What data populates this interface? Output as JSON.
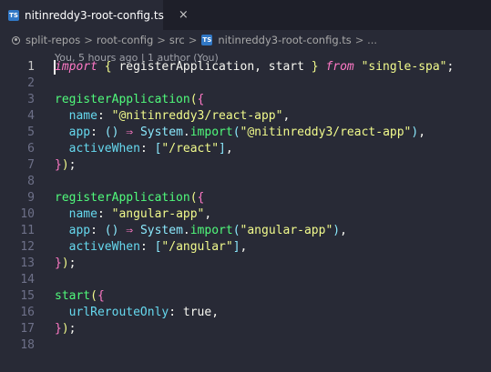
{
  "tab": {
    "label": "nitinreddy3-root-config.ts",
    "icon": "typescript-file-icon",
    "close_glyph": "×",
    "icon_text": "TS"
  },
  "breadcrumb": {
    "icon": "repo-icon",
    "items": [
      "split-repos",
      "root-config",
      "src"
    ],
    "separator": ">",
    "file": "nitinreddy3-root-config.ts",
    "ellipsis": "> ..."
  },
  "codelens": "You, 5 hours ago | 1 author (You)",
  "active_line": 1,
  "colors": {
    "background": "#282a36",
    "keyword": "#ff79c6",
    "function": "#50fa7b",
    "string": "#f1fa8c",
    "property": "#66d9ef"
  },
  "lines": [
    {
      "n": "1",
      "tokens": [
        {
          "t": "import",
          "c": "kw"
        },
        {
          "t": " ",
          "c": "txt"
        },
        {
          "t": "{",
          "c": "b1"
        },
        {
          "t": " registerApplication, start ",
          "c": "txt"
        },
        {
          "t": "}",
          "c": "b1"
        },
        {
          "t": " ",
          "c": "txt"
        },
        {
          "t": "from",
          "c": "kw"
        },
        {
          "t": " ",
          "c": "txt"
        },
        {
          "t": "\"single-spa\"",
          "c": "str"
        },
        {
          "t": ";",
          "c": "txt"
        }
      ]
    },
    {
      "n": "2",
      "tokens": []
    },
    {
      "n": "3",
      "tokens": [
        {
          "t": "registerApplication",
          "c": "fn"
        },
        {
          "t": "(",
          "c": "b1"
        },
        {
          "t": "{",
          "c": "b2"
        }
      ]
    },
    {
      "n": "4",
      "tokens": [
        {
          "t": "  ",
          "c": "txt"
        },
        {
          "t": "name",
          "c": "prop"
        },
        {
          "t": ": ",
          "c": "txt"
        },
        {
          "t": "\"@nitinreddy3/react-app\"",
          "c": "str"
        },
        {
          "t": ",",
          "c": "txt"
        }
      ]
    },
    {
      "n": "5",
      "tokens": [
        {
          "t": "  ",
          "c": "txt"
        },
        {
          "t": "app",
          "c": "prop"
        },
        {
          "t": ": ",
          "c": "txt"
        },
        {
          "t": "()",
          "c": "b3"
        },
        {
          "t": " ",
          "c": "txt"
        },
        {
          "t": "⇒",
          "c": "op"
        },
        {
          "t": " ",
          "c": "txt"
        },
        {
          "t": "System",
          "c": "obj"
        },
        {
          "t": ".",
          "c": "txt"
        },
        {
          "t": "import",
          "c": "fn"
        },
        {
          "t": "(",
          "c": "b3"
        },
        {
          "t": "\"@nitinreddy3/react-app\"",
          "c": "str"
        },
        {
          "t": ")",
          "c": "b3"
        },
        {
          "t": ",",
          "c": "txt"
        }
      ]
    },
    {
      "n": "6",
      "tokens": [
        {
          "t": "  ",
          "c": "txt"
        },
        {
          "t": "activeWhen",
          "c": "prop"
        },
        {
          "t": ": ",
          "c": "txt"
        },
        {
          "t": "[",
          "c": "b3"
        },
        {
          "t": "\"/react\"",
          "c": "str"
        },
        {
          "t": "]",
          "c": "b3"
        },
        {
          "t": ",",
          "c": "txt"
        }
      ]
    },
    {
      "n": "7",
      "tokens": [
        {
          "t": "}",
          "c": "b2"
        },
        {
          "t": ")",
          "c": "b1"
        },
        {
          "t": ";",
          "c": "txt"
        }
      ]
    },
    {
      "n": "8",
      "tokens": []
    },
    {
      "n": "9",
      "tokens": [
        {
          "t": "registerApplication",
          "c": "fn"
        },
        {
          "t": "(",
          "c": "b1"
        },
        {
          "t": "{",
          "c": "b2"
        }
      ]
    },
    {
      "n": "10",
      "tokens": [
        {
          "t": "  ",
          "c": "txt"
        },
        {
          "t": "name",
          "c": "prop"
        },
        {
          "t": ": ",
          "c": "txt"
        },
        {
          "t": "\"angular-app\"",
          "c": "str"
        },
        {
          "t": ",",
          "c": "txt"
        }
      ]
    },
    {
      "n": "11",
      "tokens": [
        {
          "t": "  ",
          "c": "txt"
        },
        {
          "t": "app",
          "c": "prop"
        },
        {
          "t": ": ",
          "c": "txt"
        },
        {
          "t": "()",
          "c": "b3"
        },
        {
          "t": " ",
          "c": "txt"
        },
        {
          "t": "⇒",
          "c": "op"
        },
        {
          "t": " ",
          "c": "txt"
        },
        {
          "t": "System",
          "c": "obj"
        },
        {
          "t": ".",
          "c": "txt"
        },
        {
          "t": "import",
          "c": "fn"
        },
        {
          "t": "(",
          "c": "b3"
        },
        {
          "t": "\"angular-app\"",
          "c": "str"
        },
        {
          "t": ")",
          "c": "b3"
        },
        {
          "t": ",",
          "c": "txt"
        }
      ]
    },
    {
      "n": "12",
      "tokens": [
        {
          "t": "  ",
          "c": "txt"
        },
        {
          "t": "activeWhen",
          "c": "prop"
        },
        {
          "t": ": ",
          "c": "txt"
        },
        {
          "t": "[",
          "c": "b3"
        },
        {
          "t": "\"/angular\"",
          "c": "str"
        },
        {
          "t": "]",
          "c": "b3"
        },
        {
          "t": ",",
          "c": "txt"
        }
      ]
    },
    {
      "n": "13",
      "tokens": [
        {
          "t": "}",
          "c": "b2"
        },
        {
          "t": ")",
          "c": "b1"
        },
        {
          "t": ";",
          "c": "txt"
        }
      ]
    },
    {
      "n": "14",
      "tokens": []
    },
    {
      "n": "15",
      "tokens": [
        {
          "t": "start",
          "c": "fn"
        },
        {
          "t": "(",
          "c": "b1"
        },
        {
          "t": "{",
          "c": "b2"
        }
      ]
    },
    {
      "n": "16",
      "tokens": [
        {
          "t": "  ",
          "c": "txt"
        },
        {
          "t": "urlRerouteOnly",
          "c": "prop"
        },
        {
          "t": ": ",
          "c": "txt"
        },
        {
          "t": "true",
          "c": "txt"
        },
        {
          "t": ",",
          "c": "txt"
        }
      ]
    },
    {
      "n": "17",
      "tokens": [
        {
          "t": "}",
          "c": "b2"
        },
        {
          "t": ")",
          "c": "b1"
        },
        {
          "t": ";",
          "c": "txt"
        }
      ]
    },
    {
      "n": "18",
      "tokens": []
    }
  ]
}
